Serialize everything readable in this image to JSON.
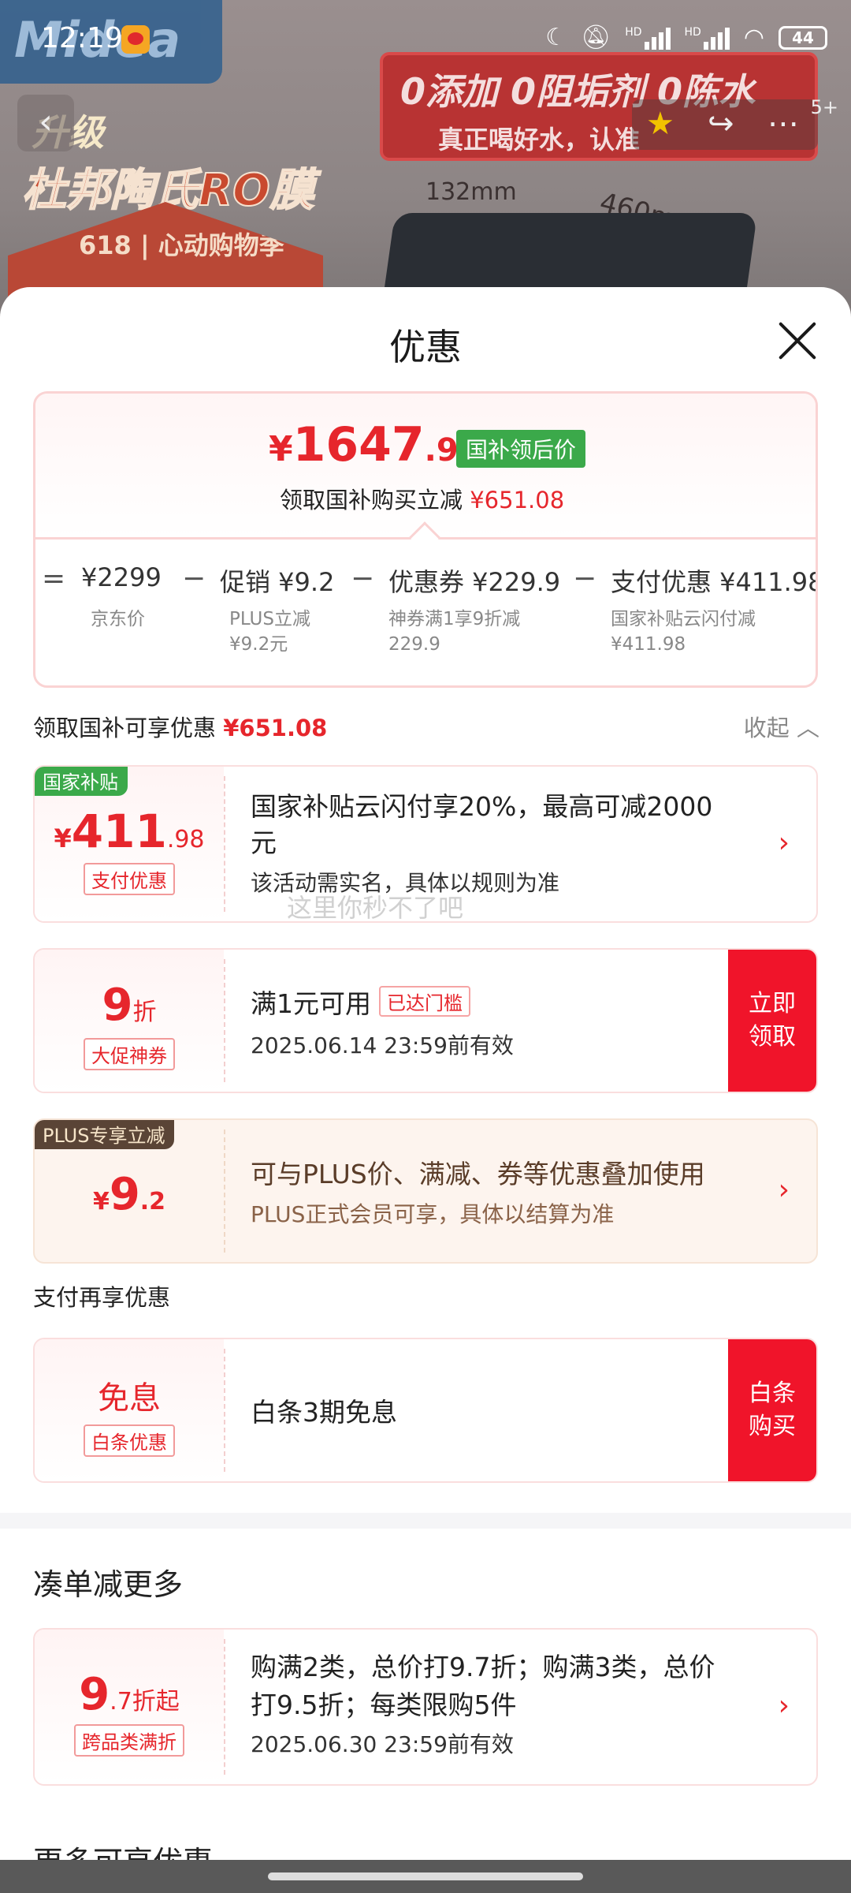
{
  "status": {
    "time": "12:19",
    "battery": "44",
    "hd1": "HD",
    "hd2": "HD"
  },
  "background": {
    "brand": "Midea",
    "banner_line1": "0添加 0阻垢剂 0陈水",
    "banner_line2": "真正喝好水，认准",
    "title1": "升级",
    "title2": "杜邦陶氏RO膜",
    "promo": "618 | 心动购物季",
    "dim_width": "132mm",
    "dim_depth": "460mm",
    "badge_count": "5+"
  },
  "sheet": {
    "title": "优惠",
    "summary": {
      "currency": "¥",
      "price_int": "1647",
      "price_dec": ".92",
      "tag": "国补领后价",
      "sub_label": "领取国补购买立减",
      "sub_value": "¥651.08",
      "formula": {
        "eq": "=",
        "jd_price": "¥2299",
        "jd_label": "京东价",
        "minus1": "−",
        "promo": "促销 ¥9.2",
        "promo_note1": "PLUS立减",
        "promo_note2": "¥9.2元",
        "minus2": "−",
        "coupon": "优惠券 ¥229.9",
        "coupon_note1": "神券满1享9折减",
        "coupon_note2": "229.9",
        "minus3": "−",
        "pay": "支付优惠 ¥411.98",
        "pay_note1": "国家补贴云闪付减",
        "pay_note2": "¥411.98"
      }
    },
    "section1": {
      "label": "领取国补可享优惠",
      "value": "¥651.08",
      "collapse": "收起"
    },
    "cards": {
      "subsidy": {
        "corner": "国家补贴",
        "cur": "¥",
        "amount": "411",
        "dec": ".98",
        "tag": "支付优惠",
        "title_line1": "国家补贴云闪付享20%，最高可减2000",
        "title_line2": "元",
        "sub": "该活动需实名，具体以规则为准"
      },
      "coupon": {
        "amount": "9",
        "unit": "折",
        "tag": "大促神券",
        "title": "满1元可用",
        "reached": "已达门槛",
        "sub": "2025.06.14 23:59前有效",
        "button": "立即领取"
      },
      "plus": {
        "corner": "PLUS专享立减",
        "cur": "¥",
        "amount": "9",
        "dec": ".2",
        "title": "可与PLUS价、满减、券等优惠叠加使用",
        "sub": "PLUS正式会员可享，具体以结算为准"
      },
      "baitiao": {
        "amount": "免息",
        "tag": "白条优惠",
        "title": "白条3期免息",
        "button": "白条购买"
      },
      "cross": {
        "amount": "9",
        "unit": ".7折起",
        "tag": "跨品类满折",
        "title_line1": "购满2类，总价打9.7折；购满3类，总价",
        "title_line2": "打9.5折；每类限购5件",
        "sub": "2025.06.30 23:59前有效"
      }
    },
    "watermark": "这里你秒不了吧",
    "pay_section": "支付再享优惠",
    "more_section": "凑单减更多",
    "more2_section": "更多可享优惠"
  },
  "colors": {
    "accent_red": "#e6262c",
    "button_red": "#f0142a",
    "green_tag": "#3ba94a",
    "plus_brown": "#5a4436"
  }
}
